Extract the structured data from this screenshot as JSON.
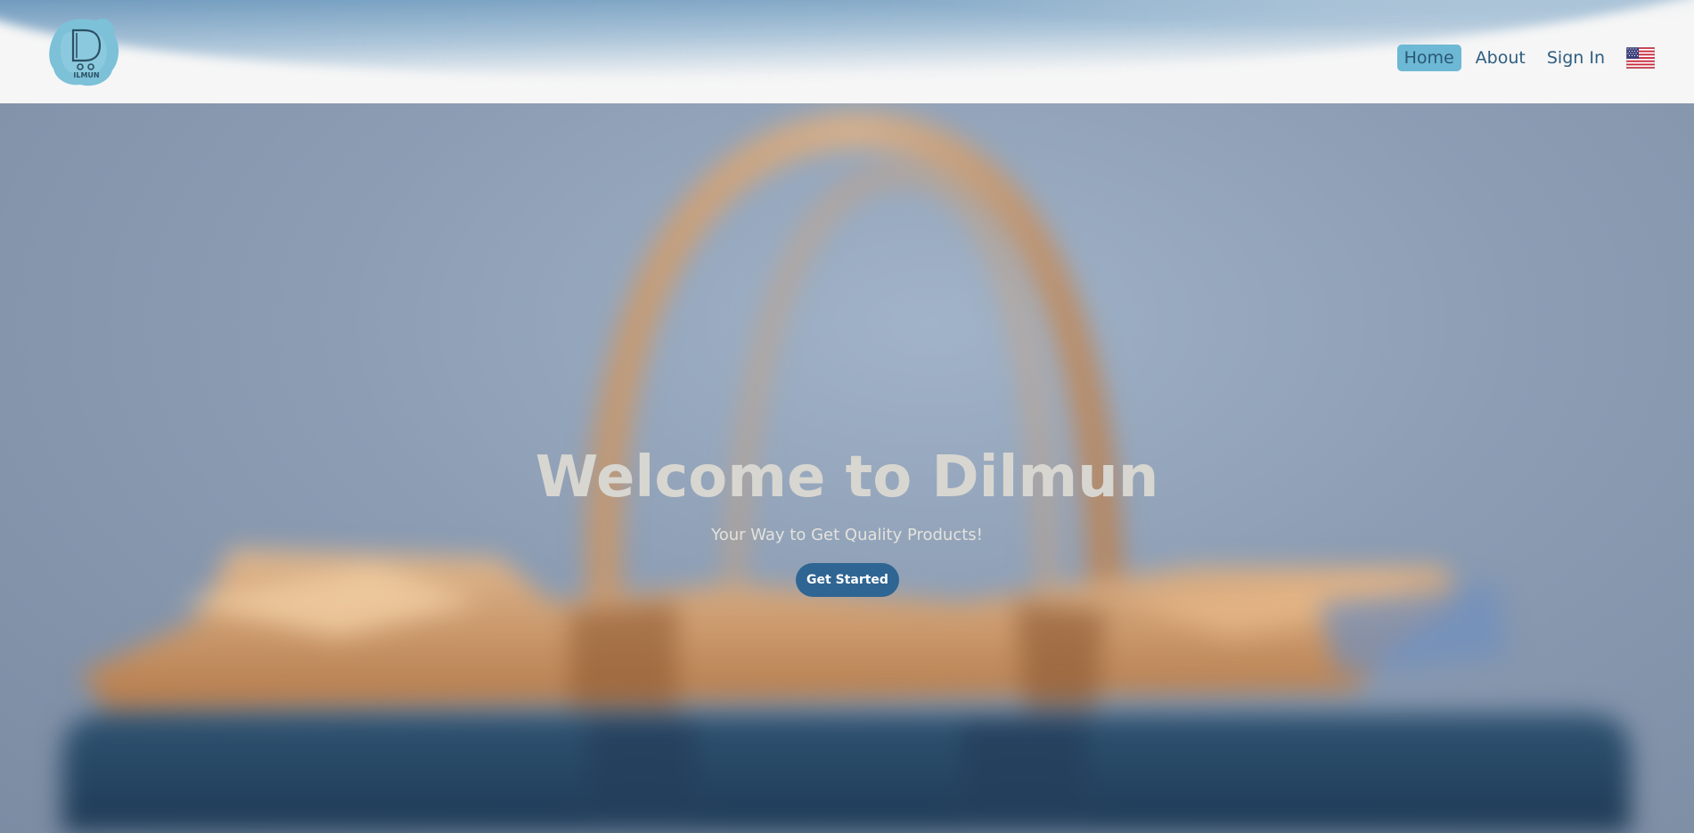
{
  "brand": {
    "logo_text": "ILMUN",
    "logo_letter": "D"
  },
  "nav": {
    "items": [
      {
        "label": "Home",
        "active": true
      },
      {
        "label": "About",
        "active": false
      },
      {
        "label": "Sign In",
        "active": false
      }
    ],
    "language_icon": "us-flag-icon"
  },
  "hero": {
    "title": "Welcome to Dilmun",
    "subtitle": "Your Way to Get Quality Products!",
    "cta_label": "Get Started",
    "background_image": "blurred-shopping-bag"
  },
  "colors": {
    "accent": "#6db8d4",
    "nav_text": "#2f5d80",
    "cta": "#2f6593",
    "hero_title": "#d8d6d0"
  }
}
